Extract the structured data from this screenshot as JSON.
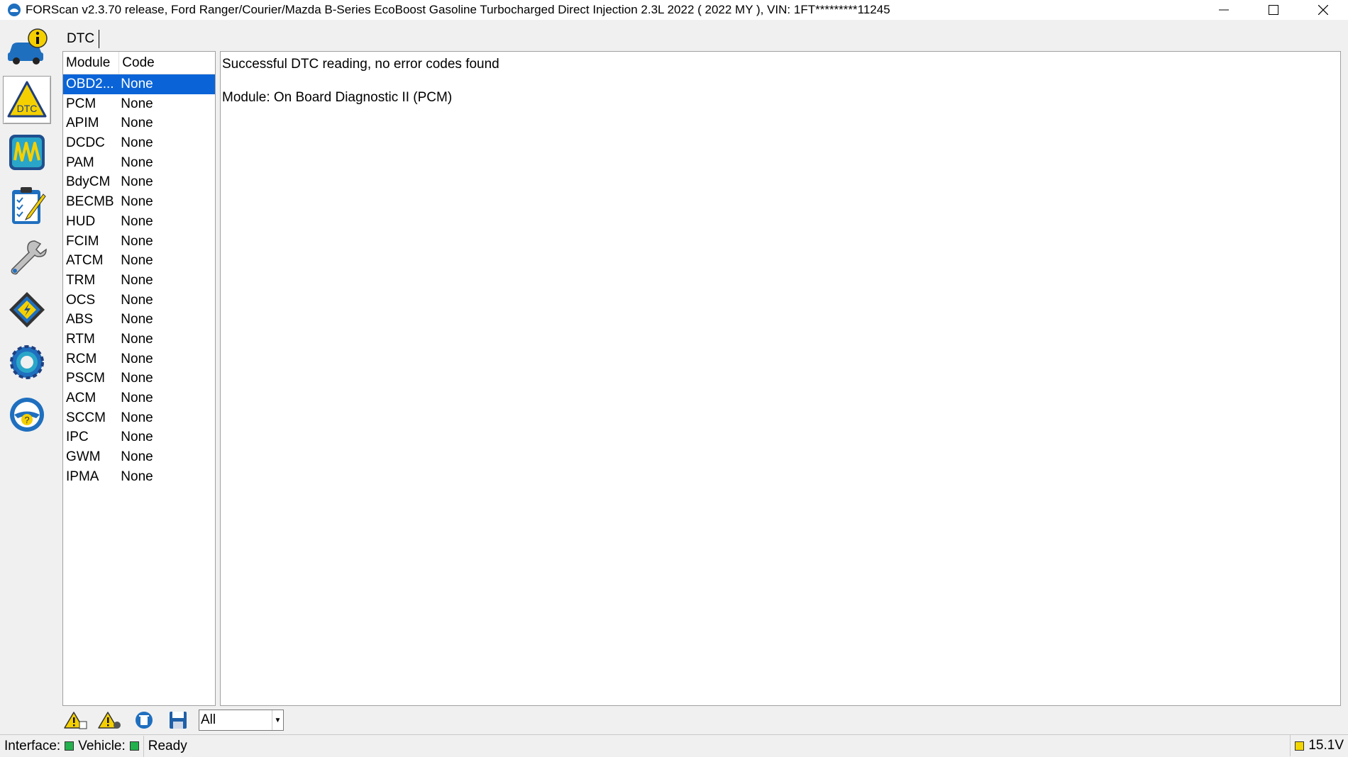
{
  "window": {
    "title": "FORScan v2.3.70 release, Ford Ranger/Courier/Mazda B-Series EcoBoost Gasoline Turbocharged Direct Injection 2.3L 2022 ( 2022 MY ), VIN: 1FT*********11245"
  },
  "toolbar": {
    "items": [
      {
        "name": "vehicle-info",
        "icon": "car-info-icon"
      },
      {
        "name": "dtc",
        "icon": "dtc-warning-icon",
        "label": "DTC",
        "active": true
      },
      {
        "name": "oscilloscope",
        "icon": "oscilloscope-icon"
      },
      {
        "name": "tests",
        "icon": "checklist-icon"
      },
      {
        "name": "service",
        "icon": "wrench-icon"
      },
      {
        "name": "configuration",
        "icon": "chip-icon"
      },
      {
        "name": "settings",
        "icon": "gear-icon"
      },
      {
        "name": "help",
        "icon": "help-steering-icon",
        "label": "?"
      }
    ]
  },
  "tabs": [
    {
      "label": "DTC"
    }
  ],
  "dtc_list": {
    "headers": {
      "module": "Module",
      "code": "Code"
    },
    "rows": [
      {
        "module": "OBD2...",
        "code": "None"
      },
      {
        "module": "PCM",
        "code": "None"
      },
      {
        "module": "APIM",
        "code": "None"
      },
      {
        "module": "DCDC",
        "code": "None"
      },
      {
        "module": "PAM",
        "code": "None"
      },
      {
        "module": "BdyCM",
        "code": "None"
      },
      {
        "module": "BECMB",
        "code": "None"
      },
      {
        "module": "HUD",
        "code": "None"
      },
      {
        "module": "FCIM",
        "code": "None"
      },
      {
        "module": "ATCM",
        "code": "None"
      },
      {
        "module": "TRM",
        "code": "None"
      },
      {
        "module": "OCS",
        "code": "None"
      },
      {
        "module": "ABS",
        "code": "None"
      },
      {
        "module": "RTM",
        "code": "None"
      },
      {
        "module": "RCM",
        "code": "None"
      },
      {
        "module": "PSCM",
        "code": "None"
      },
      {
        "module": "ACM",
        "code": "None"
      },
      {
        "module": "SCCM",
        "code": "None"
      },
      {
        "module": "IPC",
        "code": "None"
      },
      {
        "module": "GWM",
        "code": "None"
      },
      {
        "module": "IPMA",
        "code": "None"
      }
    ]
  },
  "detail": {
    "message": "Successful DTC reading, no error codes found",
    "module_line": "Module: On Board Diagnostic II (PCM)"
  },
  "bottom_bar": {
    "buttons": [
      {
        "icon": "warning-read-icon"
      },
      {
        "icon": "warning-clear-icon"
      },
      {
        "icon": "clear-dtc-icon"
      },
      {
        "icon": "save-icon"
      }
    ],
    "filter": {
      "selected": "All"
    }
  },
  "statusbar": {
    "interface_label": "Interface:",
    "vehicle_label": "Vehicle:",
    "status": "Ready",
    "voltage": "15.1V",
    "colors": {
      "interface": "#22b14c",
      "vehicle": "#22b14c",
      "voltage": "#f2d600"
    }
  }
}
